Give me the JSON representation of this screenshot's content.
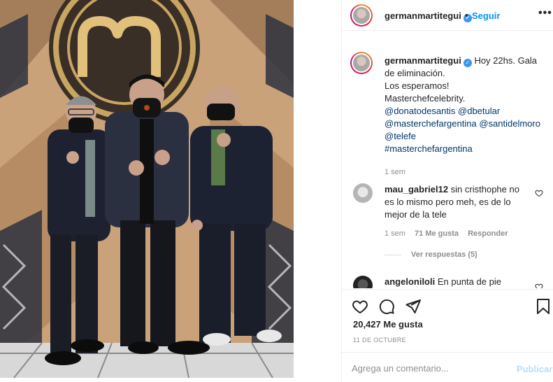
{
  "post": {
    "username": "germanmartitegui",
    "verified": true,
    "dot": "•",
    "follow_label": "Seguir",
    "more_icon": "more-dots-icon"
  },
  "caption": {
    "username": "germanmartitegui",
    "lines": [
      "Hoy 22hs. Gala",
      "de eliminación.",
      "Los esperamos!",
      "Masterchefcelebrity."
    ],
    "mentions": [
      [
        "@donatodesantis",
        "@dbetular"
      ],
      [
        "@masterchefargentina",
        "@santidelmoro"
      ],
      [
        "@telefe"
      ],
      [
        "#masterchefargentina"
      ]
    ],
    "time": "1 sem"
  },
  "comments": [
    {
      "username": "mau_gabriel12",
      "text_line1": "sin cristhophe no",
      "text_line2": "es lo mismo pero meh, es de lo",
      "text_line3": "mejor de la tele",
      "time": "1 sem",
      "likes": "71 Me gusta",
      "reply": "Responder",
      "view_replies": "Ver respuestas (5)"
    },
    {
      "username": "angeloniloli",
      "text": "En punta de pie"
    }
  ],
  "actions": {
    "like_icon": "heart-icon",
    "comment_icon": "comment-icon",
    "share_icon": "share-icon",
    "save_icon": "bookmark-icon",
    "likes": "20,427 Me gusta",
    "date": "11 DE OCTUBRE"
  },
  "add_comment": {
    "placeholder": "Agrega un comentario...",
    "publish_label": "Publicar"
  },
  "colors": {
    "accent": "#0095f6",
    "publish_disabled": "#b2dffc",
    "muted": "#8e8e8e"
  }
}
